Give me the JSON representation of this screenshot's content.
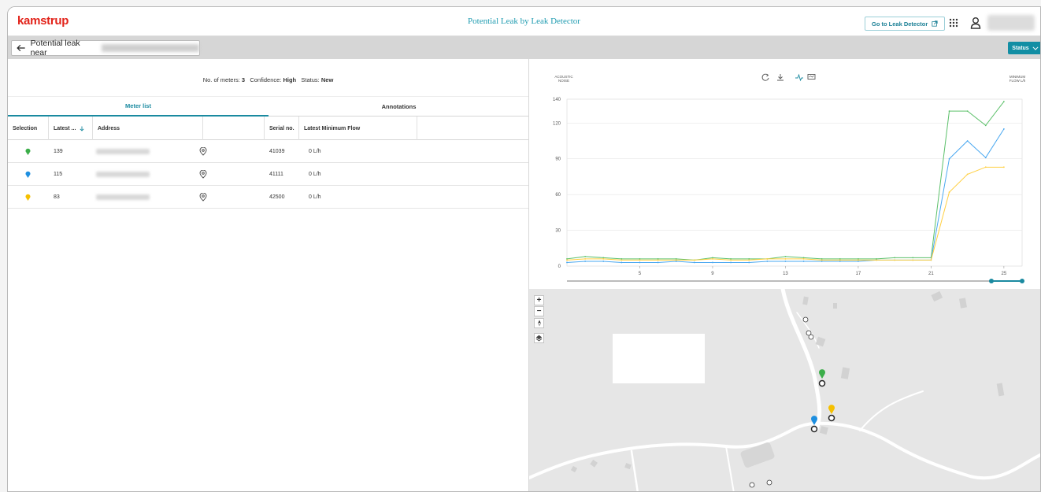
{
  "app": {
    "logo": "kamstrup",
    "title": "Potential Leak by Leak Detector",
    "goto_label": "Go to Leak Detector"
  },
  "subheader": {
    "back_label": "Potential leak near",
    "status_label": "Status"
  },
  "summary": {
    "meters_label": "No. of meters:",
    "meters_value": "3",
    "confidence_label": "Confidence:",
    "confidence_value": "High",
    "status_label": "Status:",
    "status_value": "New"
  },
  "tabs": [
    {
      "label": "Meter list",
      "active": true
    },
    {
      "label": "Annotations",
      "active": false
    }
  ],
  "table": {
    "headers": [
      "Selection",
      "Latest ...",
      "Address",
      "",
      "Serial no.",
      "Latest Minimum Flow"
    ],
    "rows": [
      {
        "color": "#3cae4a",
        "latest": "139",
        "serial": "41039",
        "flow": "0 L/h"
      },
      {
        "color": "#1e8fe0",
        "latest": "115",
        "serial": "41111",
        "flow": "0 L/h"
      },
      {
        "color": "#f5c000",
        "latest": "83",
        "serial": "42500",
        "flow": "0 L/h"
      }
    ]
  },
  "chart_data": {
    "type": "line",
    "y_left_label": "ACOUSTIC NOISE",
    "y_right_label": "MINIMUM FLOW L/h",
    "ylim": [
      0,
      140
    ],
    "yticks": [
      0,
      30,
      60,
      90,
      120,
      140
    ],
    "xlim": [
      1,
      26
    ],
    "xticks": [
      5,
      9,
      13,
      17,
      21,
      25
    ],
    "x": [
      1,
      2,
      3,
      4,
      5,
      6,
      7,
      8,
      9,
      10,
      11,
      12,
      13,
      14,
      15,
      16,
      17,
      18,
      19,
      20,
      21,
      22,
      23,
      24,
      25
    ],
    "series": [
      {
        "color": "#5cc06a",
        "values": [
          6,
          8,
          7,
          6,
          6,
          6,
          6,
          5,
          7,
          6,
          6,
          6,
          8,
          7,
          6,
          6,
          6,
          6,
          7,
          7,
          7,
          130,
          130,
          118,
          138
        ]
      },
      {
        "color": "#4aa8f0",
        "values": [
          3,
          4,
          4,
          3,
          3,
          3,
          4,
          3,
          3,
          3,
          3,
          4,
          4,
          4,
          4,
          4,
          4,
          5,
          5,
          5,
          5,
          90,
          105,
          91,
          115
        ]
      },
      {
        "color": "#ffcf40",
        "values": [
          5,
          6,
          6,
          5,
          5,
          5,
          5,
          5,
          6,
          5,
          5,
          6,
          6,
          6,
          5,
          5,
          5,
          5,
          5,
          5,
          5,
          62,
          77,
          83,
          83
        ]
      }
    ],
    "grid": true
  },
  "map": {
    "zoom_in": "+",
    "zoom_out": "−"
  },
  "colors": {
    "accent": "#128ea4",
    "brand": "#e2231a"
  }
}
